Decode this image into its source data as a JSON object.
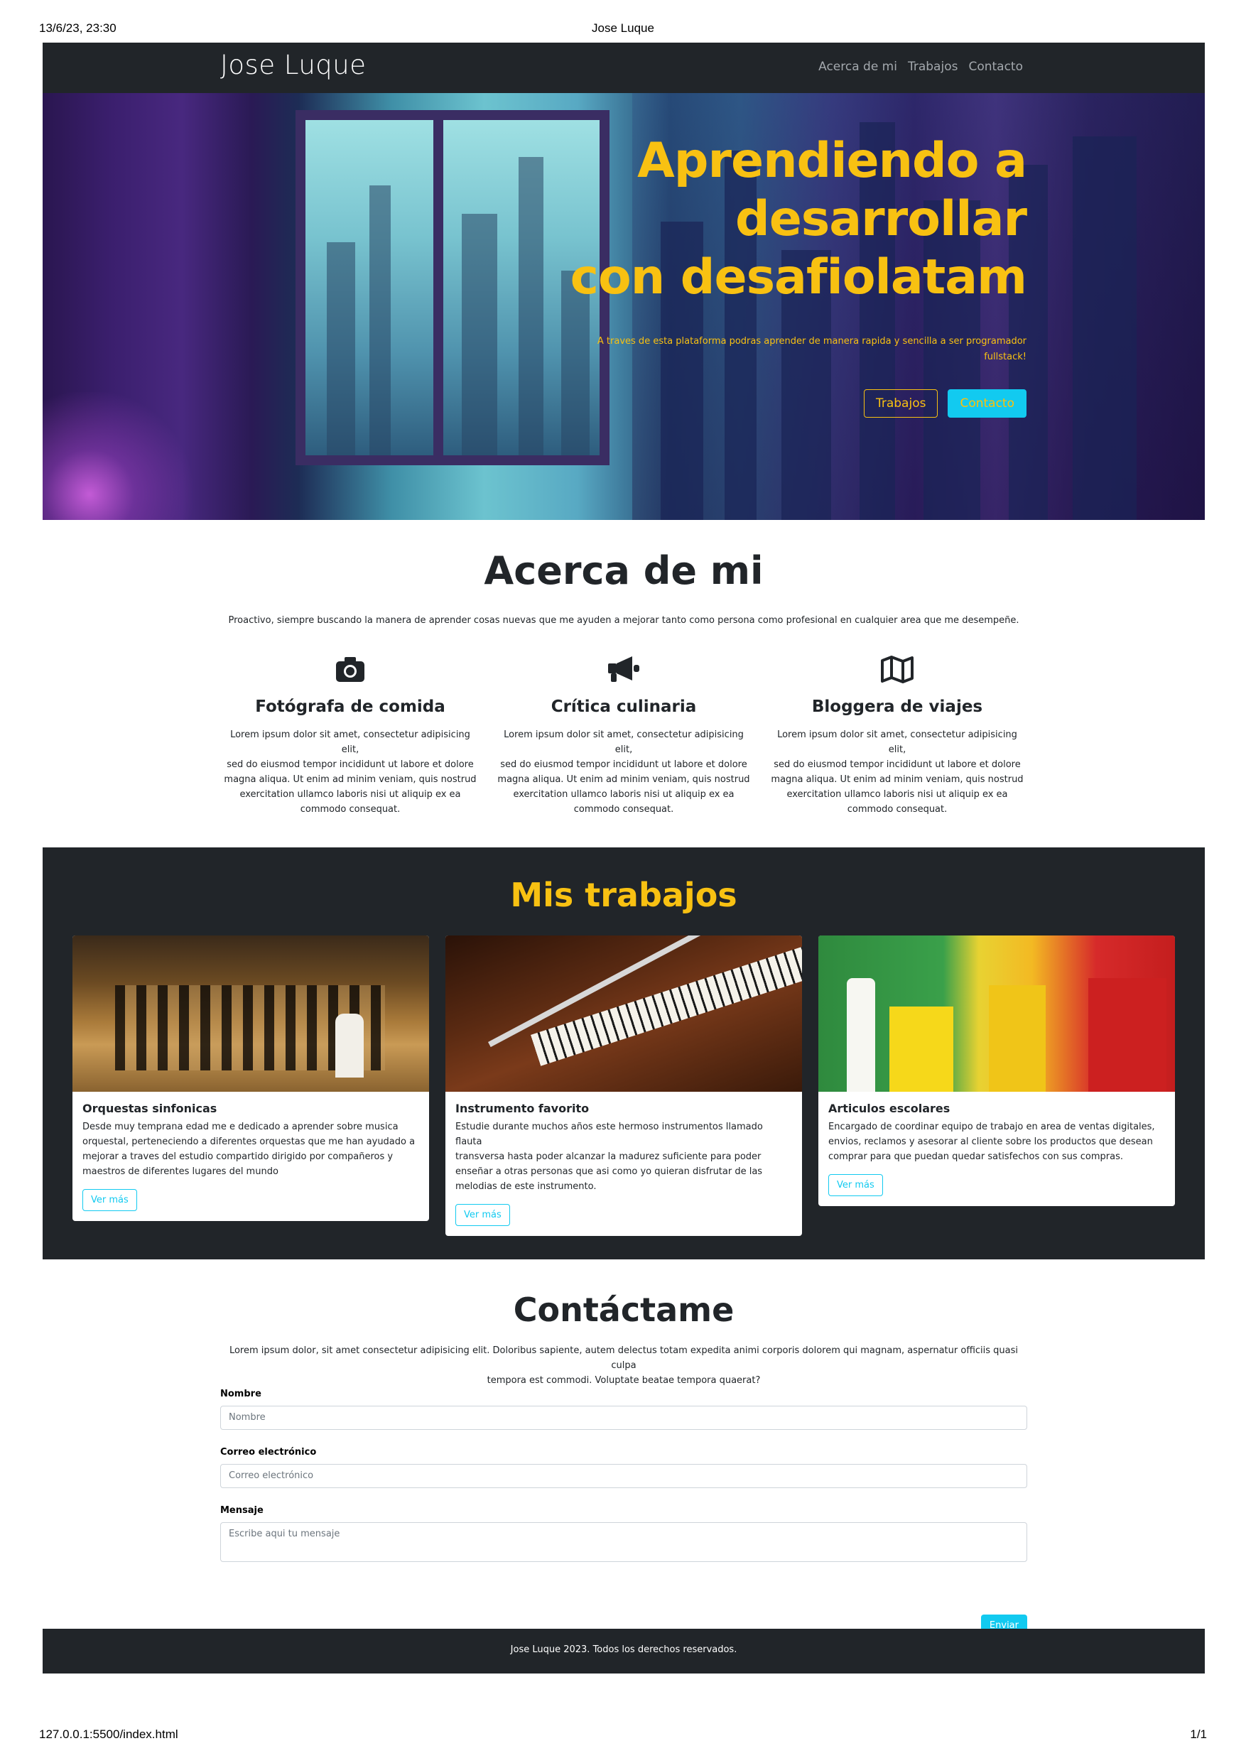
{
  "print": {
    "datetime": "13/6/23, 23:30",
    "doc_title": "Jose Luque",
    "url": "127.0.0.1:5500/index.html",
    "page": "1/1"
  },
  "navbar": {
    "brand": "Jose Luque",
    "links": [
      "Acerca de mi",
      "Trabajos",
      "Contacto"
    ]
  },
  "hero": {
    "title_lines": [
      "Aprendiendo a",
      "desarrollar",
      "con desafiolatam"
    ],
    "subtitle_lines": [
      "A traves de esta plataforma podras aprender de manera rapida y sencilla a ser programador",
      "fullstack!"
    ],
    "btn_trabajos": "Trabajos",
    "btn_contacto": "Contacto"
  },
  "about": {
    "title": "Acerca de mi",
    "lead": "Proactivo, siempre buscando la manera de aprender cosas nuevas que me ayuden a mejorar tanto como persona como profesional en cualquier area que me desempeñe.",
    "features": [
      {
        "icon": "camera-icon",
        "title": "Fotógrafa de comida",
        "text_lines": [
          "Lorem ipsum dolor sit amet, consectetur adipisicing elit,",
          "sed do eiusmod tempor incididunt ut labore et dolore",
          "magna aliqua. Ut enim ad minim veniam, quis nostrud",
          "exercitation ullamco laboris nisi ut aliquip ex ea",
          "commodo consequat."
        ]
      },
      {
        "icon": "megaphone-icon",
        "title": "Crítica culinaria",
        "text_lines": [
          "Lorem ipsum dolor sit amet, consectetur adipisicing elit,",
          "sed do eiusmod tempor incididunt ut labore et dolore",
          "magna aliqua. Ut enim ad minim veniam, quis nostrud",
          "exercitation ullamco laboris nisi ut aliquip ex ea",
          "commodo consequat."
        ]
      },
      {
        "icon": "map-icon",
        "title": "Bloggera de viajes",
        "text_lines": [
          "Lorem ipsum dolor sit amet, consectetur adipisicing elit,",
          "sed do eiusmod tempor incididunt ut labore et dolore",
          "magna aliqua. Ut enim ad minim veniam, quis nostrud",
          "exercitation ullamco laboris nisi ut aliquip ex ea",
          "commodo consequat."
        ]
      }
    ]
  },
  "works": {
    "title": "Mis trabajos",
    "cards": [
      {
        "title": "Orquestas sinfonicas",
        "text_lines": [
          "Desde muy temprana edad me e dedicado a aprender sobre musica",
          "orquestal, perteneciendo a diferentes orquestas que me han ayudado a",
          "mejorar a traves del estudio compartido dirigido por compañeros y",
          "maestros de diferentes lugares del mundo"
        ],
        "button": "Ver más"
      },
      {
        "title": "Instrumento favorito",
        "text_lines": [
          "Estudie durante muchos años este hermoso instrumentos llamado flauta",
          "transversa hasta poder alcanzar la madurez suficiente para poder",
          "enseñar a otras personas que asi como yo quieran disfrutar de las",
          "melodias de este instrumento."
        ],
        "button": "Ver más"
      },
      {
        "title": "Articulos escolares",
        "text_lines": [
          "Encargado de coordinar equipo de trabajo en area de ventas digitales,",
          "envios, reclamos y asesorar al cliente sobre los productos que desean",
          "comprar para que puedan quedar satisfechos con sus compras."
        ],
        "button": "Ver más"
      }
    ]
  },
  "contact": {
    "title": "Contáctame",
    "lead_lines": [
      "Lorem ipsum dolor, sit amet consectetur adipisicing elit. Doloribus sapiente, autem delectus totam expedita animi corporis dolorem qui magnam, aspernatur officiis quasi culpa",
      "tempora est commodi. Voluptate beatae tempora quaerat?"
    ],
    "name_label": "Nombre",
    "name_placeholder": "Nombre",
    "email_label": "Correo electrónico",
    "email_placeholder": "Correo electrónico",
    "message_label": "Mensaje",
    "message_placeholder": "Escribe aqui tu mensaje",
    "send": "Enviar"
  },
  "footer": {
    "text": "Jose Luque 2023. Todos los derechos reservados."
  },
  "colors": {
    "accent_yellow": "#f8c112",
    "info_cyan": "#12caf0",
    "dark": "#212529"
  }
}
